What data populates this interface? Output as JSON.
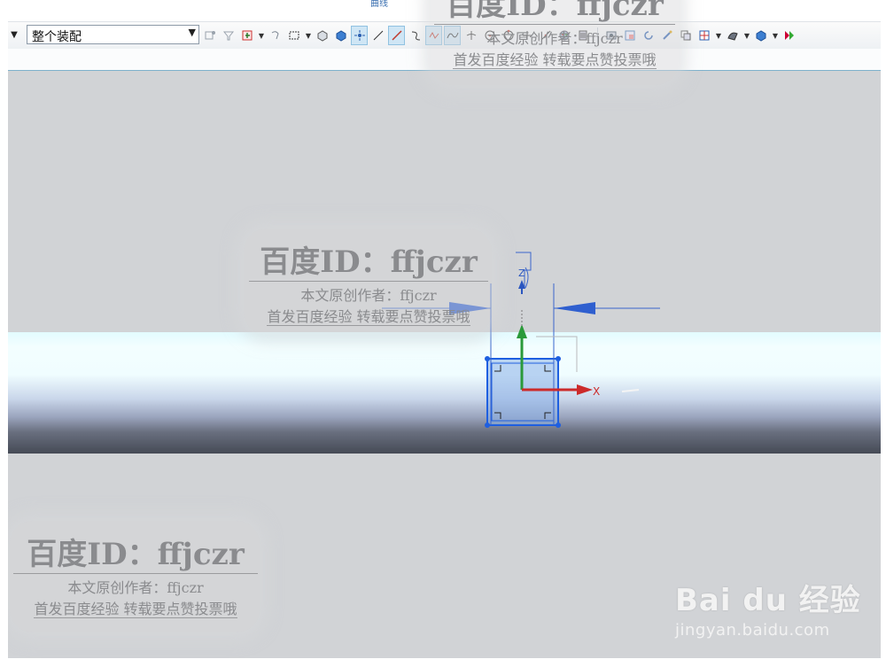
{
  "ribbon": {
    "group_title": "曲线"
  },
  "toolbar": {
    "assembly_filter": "整个装配",
    "dropdown_glyph": "▼",
    "icons": [
      "snap-point-icon",
      "filter-icon",
      "select-box-icon",
      "dropdown",
      "rotate-icon",
      "rectangle-select-icon",
      "dropdown",
      "view-cube-icon",
      "shaded-cube-icon",
      "point-snap-icon",
      "line-icon",
      "line-icon-2",
      "curve-icon",
      "polyline-icon",
      "spline-icon",
      "intersect-icon",
      "circle-center-icon",
      "circle-quadrant-icon",
      "cross-icon",
      "tangent-icon",
      "palette-icon",
      "layer-icon",
      "sep",
      "screenshot-icon",
      "frame-icon",
      "refresh-icon",
      "wand-icon",
      "copy-icon",
      "grid-icon",
      "dropdown",
      "shape-icon",
      "dropdown",
      "cube-color-icon",
      "dropdown",
      "more-icon"
    ]
  },
  "viewport": {
    "background": "#d1d3d6",
    "axis_x_label": "X",
    "axis_z_label": "Z"
  },
  "watermarks": [
    {
      "title": "百度ID：ffjczr",
      "line2": "本文原创作者：ffjczr",
      "line3": "首发百度经验 转载要点赞投票哦"
    }
  ],
  "branding": {
    "logo": "Bai du 经验",
    "url": "jingyan.baidu.com"
  }
}
